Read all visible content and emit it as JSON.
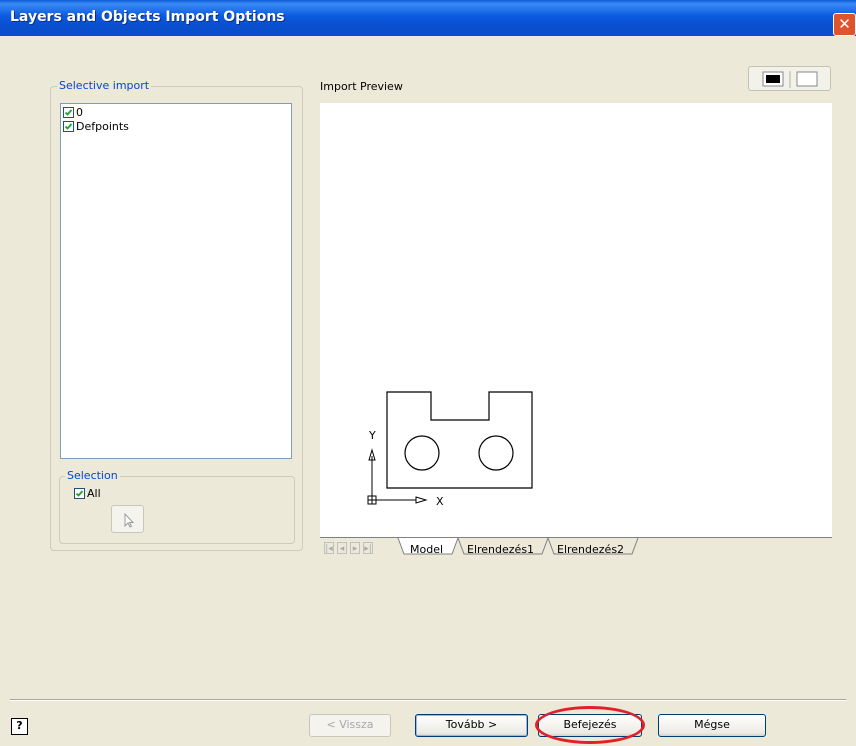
{
  "window": {
    "title": "Layers and Objects Import Options",
    "close_glyph": "✕"
  },
  "selective_import": {
    "legend": "Selective import",
    "layers": [
      {
        "label": "0",
        "checked": true
      },
      {
        "label": "Defpoints",
        "checked": true
      }
    ]
  },
  "selection": {
    "legend": "Selection",
    "all_label": "All",
    "all_checked": true
  },
  "preview": {
    "label": "Import Preview",
    "axis_x": "X",
    "axis_y": "Y",
    "tabs": [
      "Model",
      "Elrendezés1",
      "Elrendezés2"
    ],
    "active_tab": "Model"
  },
  "buttons": {
    "help": "?",
    "back": "< Vissza",
    "next": "Tovább >",
    "finish": "Befejezés",
    "cancel": "Mégse"
  },
  "colors": {
    "accent": "#0046d5",
    "highlight": "#e0202a",
    "check": "#21a121"
  }
}
